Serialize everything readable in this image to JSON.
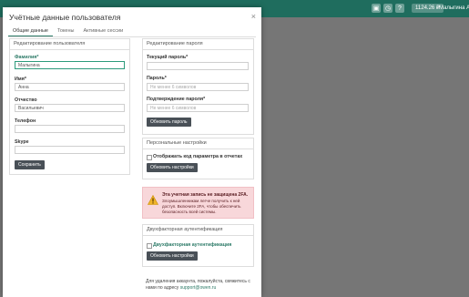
{
  "topbar": {
    "icons": [
      "wallet-icon",
      "clock-icon",
      "help-icon",
      "bell-icon",
      "mail-icon",
      "user-icon"
    ],
    "balance": "1124.26 ₽",
    "user": "Малыгина Анна"
  },
  "modal": {
    "title": "Учётные данные пользователя",
    "tabs": [
      {
        "label": "Общие данные"
      },
      {
        "label": "Токены"
      },
      {
        "label": "Активные сессии"
      }
    ]
  },
  "edit_user": {
    "header": "Редактирование пользователя",
    "last_name_label": "Фамилия*",
    "last_name_value": "Малыгина",
    "first_name_label": "Имя*",
    "first_name_value": "Анна",
    "patronymic_label": "Отчество",
    "patronymic_value": "Васильевич",
    "phone_label": "Телефон",
    "phone_value": "",
    "skype_label": "Skype",
    "skype_value": "",
    "save_label": "Сохранить"
  },
  "edit_password": {
    "header": "Редактирование пароля",
    "current_label": "Текущий пароль*",
    "password_label": "Пароль*",
    "password_placeholder": "Не менее 6 символов",
    "confirm_label": "Подтверждение пароля*",
    "confirm_placeholder": "Не менее 6 символов",
    "button_label": "Обновить пароль"
  },
  "personal_settings": {
    "header": "Персональные настройки",
    "checkbox_label": "Отображать код параметра в отчетах",
    "button_label": "Обновить настройки"
  },
  "warning": {
    "title": "Эта учетная запись не защищена 2FA.",
    "text": "Злоумышленникам легче получить к ней доступ. Включите 2FA, чтобы обеспечить безопасность всей системы."
  },
  "two_factor": {
    "header": "Двухфакторная аутентификация",
    "checkbox_label": "Двухфакторная аутентификация",
    "button_label": "Обновить настройки"
  },
  "footer": {
    "text": "Для удаления аккаунта, пожалуйста, свяжитесь с нами по адресу",
    "email": "support@owen.ru"
  },
  "colors": {
    "topbar": "#1f6d5e",
    "accent": "#2c7a67",
    "button": "#495057",
    "warning_bg": "#f8d7da"
  }
}
